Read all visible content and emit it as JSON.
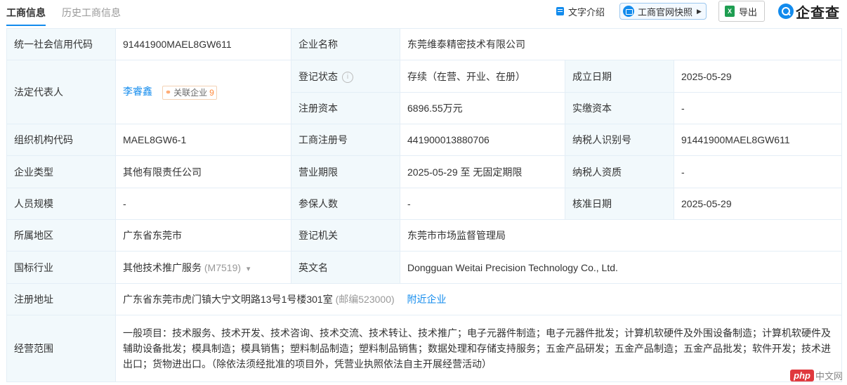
{
  "tabs": [
    {
      "label": "工商信息",
      "active": true
    },
    {
      "label": "历史工商信息",
      "active": false
    }
  ],
  "toolbar": {
    "text_intro": "文字介绍",
    "snapshot": "工商官网快照",
    "export": "导出",
    "export_icon_text": "X",
    "logo": "企查查"
  },
  "rows": {
    "credit_code": {
      "label": "统一社会信用代码",
      "value": "91441900MAEL8GW611"
    },
    "company_name": {
      "label": "企业名称",
      "value": "东莞维泰精密技术有限公司"
    },
    "legal_rep": {
      "label": "法定代表人",
      "name": "李睿鑫",
      "related_label": "关联企业",
      "related_count": "9"
    },
    "reg_status": {
      "label": "登记状态",
      "value": "存续（在营、开业、在册）"
    },
    "est_date": {
      "label": "成立日期",
      "value": "2025-05-29"
    },
    "reg_capital": {
      "label": "注册资本",
      "value": "6896.55万元"
    },
    "paid_capital": {
      "label": "实缴资本",
      "value": "-"
    },
    "org_code": {
      "label": "组织机构代码",
      "value": "MAEL8GW6-1"
    },
    "reg_no": {
      "label": "工商注册号",
      "value": "441900013880706"
    },
    "taxpayer_id": {
      "label": "纳税人识别号",
      "value": "91441900MAEL8GW611"
    },
    "company_type": {
      "label": "企业类型",
      "value": "其他有限责任公司"
    },
    "business_term": {
      "label": "营业期限",
      "value": "2025-05-29 至 无固定期限"
    },
    "taxpayer_qual": {
      "label": "纳税人资质",
      "value": "-"
    },
    "staff_size": {
      "label": "人员规模",
      "value": "-"
    },
    "insured": {
      "label": "参保人数",
      "value": "-"
    },
    "approval_date": {
      "label": "核准日期",
      "value": "2025-05-29"
    },
    "region": {
      "label": "所属地区",
      "value": "广东省东莞市"
    },
    "reg_authority": {
      "label": "登记机关",
      "value": "东莞市市场监督管理局"
    },
    "industry": {
      "label": "国标行业",
      "value": "其他技术推广服务",
      "code": "(M7519)"
    },
    "english_name": {
      "label": "英文名",
      "value": "Dongguan Weitai Precision Technology Co., Ltd."
    },
    "reg_address": {
      "label": "注册地址",
      "value": "广东省东莞市虎门镇大宁文明路13号1号楼301室",
      "postcode": "(邮编523000)",
      "nearby": "附近企业"
    },
    "business_scope": {
      "label": "经营范围",
      "value": "一般项目：技术服务、技术开发、技术咨询、技术交流、技术转让、技术推广；电子元器件制造；电子元器件批发；计算机软硬件及外围设备制造；计算机软硬件及辅助设备批发；模具制造；模具销售；塑料制品制造；塑料制品销售；数据处理和存储支持服务；五金产品研发；五金产品制造；五金产品批发；软件开发；技术进出口；货物进出口。（除依法须经批准的项目外，凭营业执照依法自主开展经营活动）"
    }
  },
  "watermark": {
    "brand": "php",
    "suffix": "中文网"
  }
}
